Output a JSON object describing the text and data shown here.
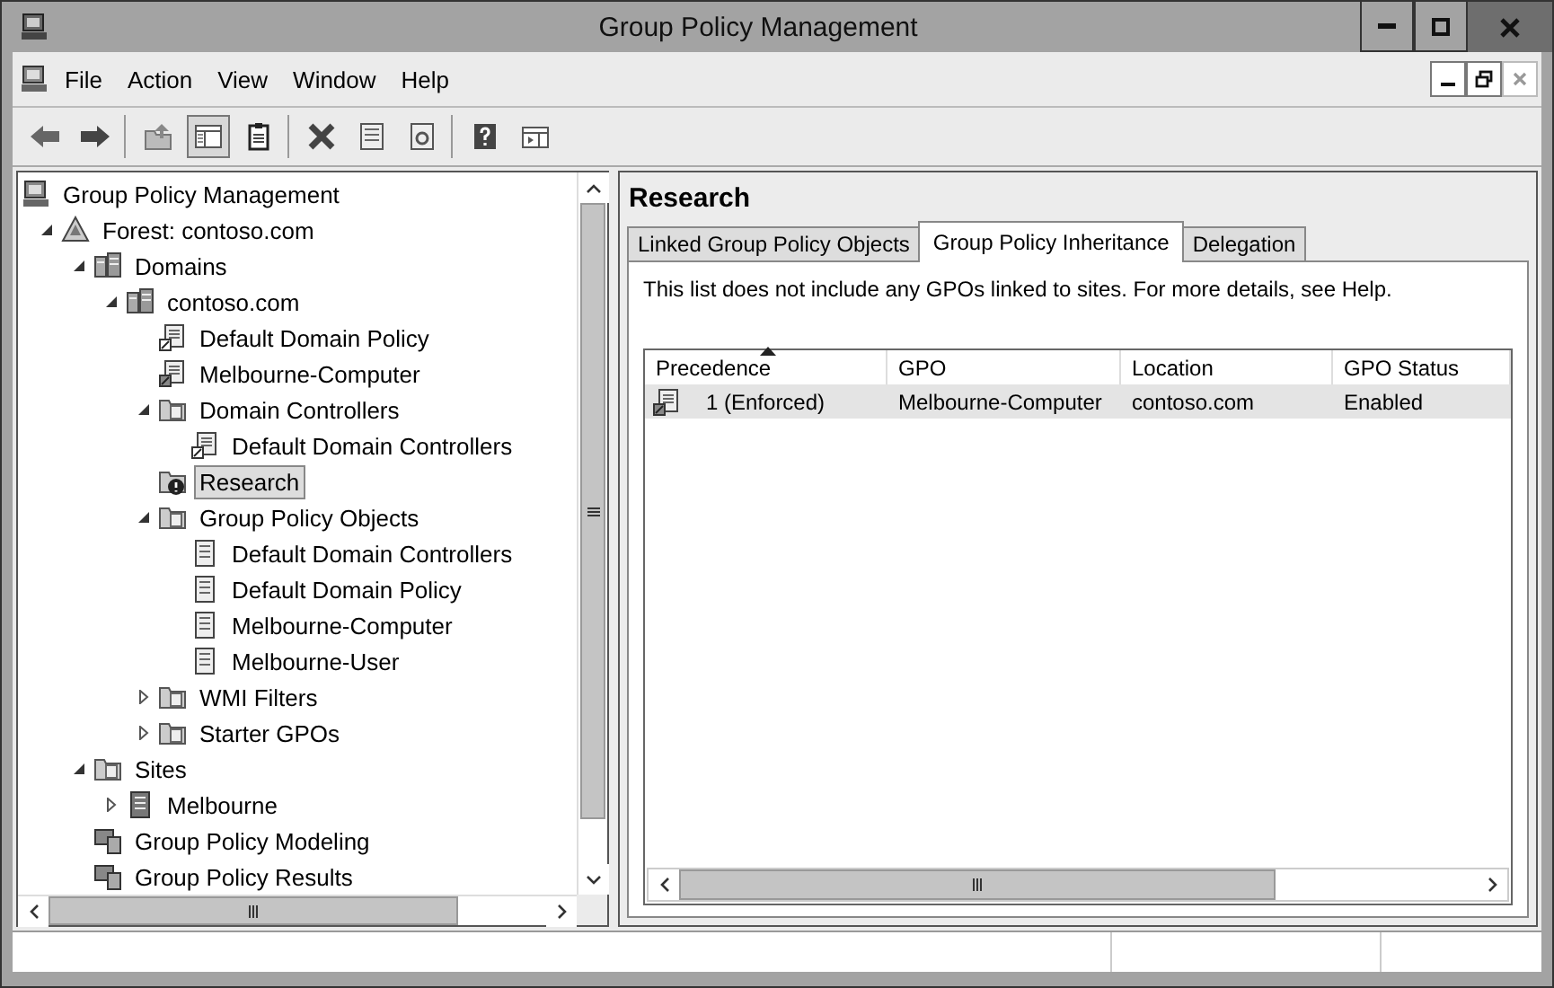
{
  "window": {
    "title": "Group Policy Management"
  },
  "menu": [
    "File",
    "Action",
    "View",
    "Window",
    "Help"
  ],
  "toolbar": [
    [
      {
        "kind": "back",
        "pressed": false
      },
      {
        "kind": "forward",
        "pressed": false
      }
    ],
    [
      {
        "kind": "up",
        "pressed": false
      },
      {
        "kind": "console-tree",
        "pressed": true
      },
      {
        "kind": "clipboard",
        "pressed": false
      }
    ],
    [
      {
        "kind": "delete",
        "pressed": false
      },
      {
        "kind": "properties",
        "pressed": false
      },
      {
        "kind": "refresh",
        "pressed": false
      }
    ],
    [
      {
        "kind": "help",
        "pressed": false
      },
      {
        "kind": "action-pane",
        "pressed": false
      }
    ]
  ],
  "tree": [
    {
      "label": "Group Policy Management",
      "kind": "root",
      "selected": false,
      "children": [
        {
          "label": "Forest: contoso.com",
          "kind": "forest",
          "selected": false,
          "expanded": true,
          "children": [
            {
              "label": "Domains",
              "kind": "domains",
              "selected": false,
              "expanded": true,
              "children": [
                {
                  "label": "contoso.com",
                  "kind": "domain",
                  "selected": false,
                  "expanded": true,
                  "children": [
                    {
                      "label": "Default Domain Policy",
                      "kind": "link",
                      "selected": false
                    },
                    {
                      "label": "Melbourne-Computer",
                      "kind": "link-enforced",
                      "selected": false
                    },
                    {
                      "label": "Domain Controllers",
                      "kind": "ou",
                      "selected": false,
                      "expanded": true,
                      "children": [
                        {
                          "label": "Default Domain Controllers",
                          "kind": "link",
                          "selected": false
                        }
                      ]
                    },
                    {
                      "label": "Research",
                      "kind": "ou-blocked",
                      "selected": true
                    },
                    {
                      "label": "Group Policy Objects",
                      "kind": "gpo-folder",
                      "selected": false,
                      "expanded": true,
                      "children": [
                        {
                          "label": "Default Domain Controllers",
                          "kind": "gpo",
                          "selected": false
                        },
                        {
                          "label": "Default Domain Policy",
                          "kind": "gpo",
                          "selected": false
                        },
                        {
                          "label": "Melbourne-Computer",
                          "kind": "gpo",
                          "selected": false
                        },
                        {
                          "label": "Melbourne-User",
                          "kind": "gpo",
                          "selected": false
                        }
                      ]
                    },
                    {
                      "label": "WMI Filters",
                      "kind": "wmi",
                      "selected": false,
                      "expanded": false
                    },
                    {
                      "label": "Starter GPOs",
                      "kind": "starter",
                      "selected": false,
                      "expanded": false
                    }
                  ]
                }
              ]
            },
            {
              "label": "Sites",
              "kind": "sites",
              "selected": false,
              "expanded": true,
              "children": [
                {
                  "label": "Melbourne",
                  "kind": "site",
                  "selected": false,
                  "expanded": false
                }
              ]
            },
            {
              "label": "Group Policy Modeling",
              "kind": "modeling",
              "selected": false
            },
            {
              "label": "Group Policy Results",
              "kind": "results",
              "selected": false
            }
          ]
        }
      ]
    }
  ],
  "details": {
    "title": "Research",
    "tabs": [
      {
        "label": "Linked Group Policy Objects",
        "selected": false
      },
      {
        "label": "Group Policy Inheritance",
        "selected": true
      },
      {
        "label": "Delegation",
        "selected": false
      }
    ],
    "note": "This list does not include any GPOs linked to sites. For more details, see Help.",
    "columns": [
      {
        "label": "Precedence",
        "sorted": true
      },
      {
        "label": "GPO",
        "sorted": false
      },
      {
        "label": "Location",
        "sorted": false
      },
      {
        "label": "GPO Status",
        "sorted": false
      }
    ],
    "rows": [
      {
        "cells": [
          "1 (Enforced)",
          "Melbourne-Computer",
          "contoso.com",
          "Enabled"
        ],
        "selected": true
      }
    ]
  }
}
